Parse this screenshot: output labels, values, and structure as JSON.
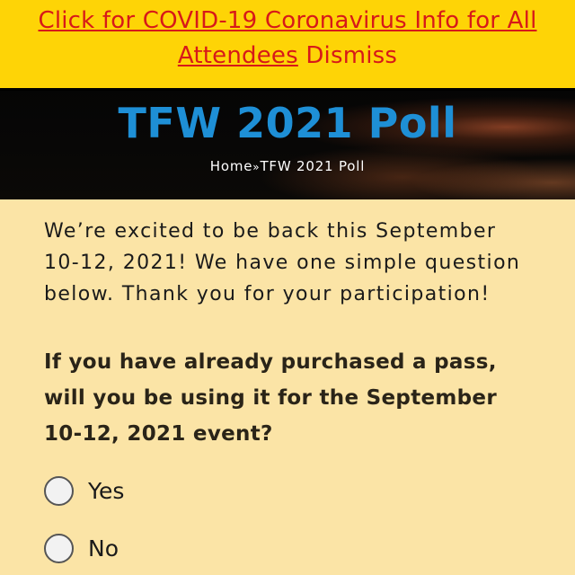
{
  "banner": {
    "link_text": "Click for COVID-19 Coronavirus Info for All Attendees",
    "dismiss_text": "Dismiss"
  },
  "hero": {
    "title": "TFW 2021 Poll",
    "breadcrumb": {
      "home": "Home",
      "separator": "»",
      "current": "TFW 2021 Poll"
    }
  },
  "content": {
    "intro": "We’re excited to be back this September 10-12, 2021! We have one simple question below. Thank you for your participation!",
    "question": "If you have already purchased a pass, will you be using it for the September 10-12, 2021 event?",
    "options": [
      {
        "label": "Yes"
      },
      {
        "label": "No"
      }
    ]
  },
  "colors": {
    "banner_bg": "#fed406",
    "banner_text": "#d71919",
    "title": "#1e8fd6",
    "page_bg": "#fbe4a6"
  }
}
